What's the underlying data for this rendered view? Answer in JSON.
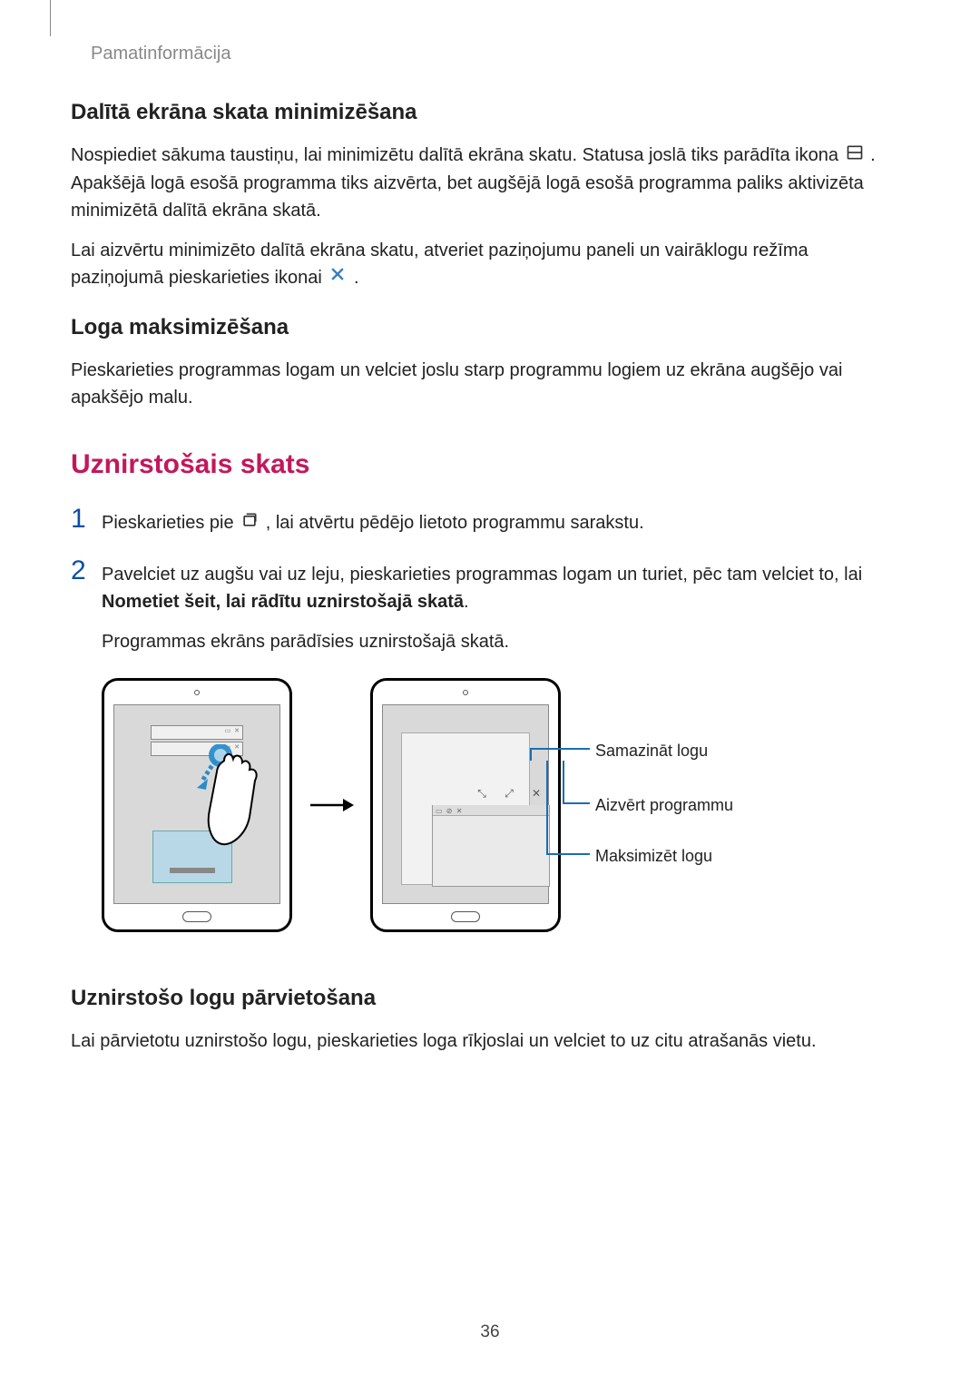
{
  "header": {
    "breadcrumb": "Pamatinformācija"
  },
  "section1": {
    "heading": "Dalītā ekrāna skata minimizēšana",
    "p1a": "Nospiediet sākuma taustiņu, lai minimizētu dalītā ekrāna skatu. Statusa joslā tiks parādīta ikona ",
    "p1b": ". Apakšējā logā esošā programma tiks aizvērta, bet augšējā logā esošā programma paliks aktivizēta minimizētā dalītā ekrāna skatā.",
    "p2a": "Lai aizvērtu minimizēto dalītā ekrāna skatu, atveriet paziņojumu paneli un vairāklogu režīma paziņojumā pieskarieties ikonai ",
    "p2b": "."
  },
  "section2": {
    "heading": "Loga maksimizēšana",
    "p1": "Pieskarieties programmas logam un velciet joslu starp programmu logiem uz ekrāna augšējo vai apakšējo malu."
  },
  "popup": {
    "heading": "Uznirstošais skats",
    "step1": {
      "num": "1",
      "a": "Pieskarieties pie ",
      "b": ", lai atvērtu pēdējo lietoto programmu sarakstu."
    },
    "step2": {
      "num": "2",
      "a": "Pavelciet uz augšu vai uz leju, pieskarieties programmas logam un turiet, pēc tam velciet to, lai ",
      "bold": "Nometiet šeit, lai rādītu uznirstošajā skatā",
      "b": ".",
      "extra": "Programmas ekrāns parādīsies uznirstošajā skatā."
    }
  },
  "callouts": {
    "minimize": "Samazināt logu",
    "close": "Aizvērt programmu",
    "maximize": "Maksimizēt logu"
  },
  "section3": {
    "heading": "Uznirstošo logu pārvietošana",
    "p1": "Lai pārvietotu uznirstošo logu, pieskarieties loga rīkjoslai un velciet to uz citu atrašanās vietu."
  },
  "page": "36"
}
